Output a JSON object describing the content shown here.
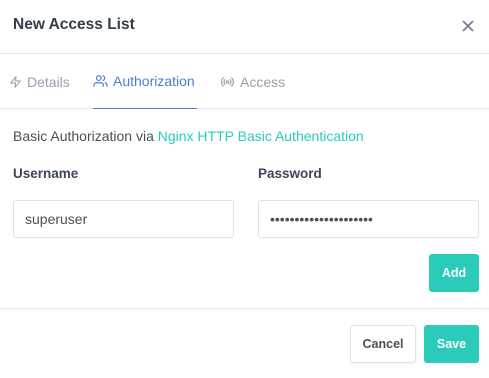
{
  "modal": {
    "title": "New Access List"
  },
  "tabs": [
    {
      "label": "Details",
      "icon": "zap-icon",
      "active": false
    },
    {
      "label": "Authorization",
      "icon": "users-icon",
      "active": true
    },
    {
      "label": "Access",
      "icon": "radio-icon",
      "active": false
    }
  ],
  "auth": {
    "description": "Basic Authorization via ",
    "link_text": "Nginx HTTP Basic Authentication",
    "username_label": "Username",
    "password_label": "Password",
    "username_value": "superuser",
    "password_value": "password1234567890abc",
    "add_label": "Add"
  },
  "footer": {
    "cancel_label": "Cancel",
    "save_label": "Save"
  },
  "colors": {
    "accent": "#2bcbba",
    "active_tab": "#467fcf"
  }
}
